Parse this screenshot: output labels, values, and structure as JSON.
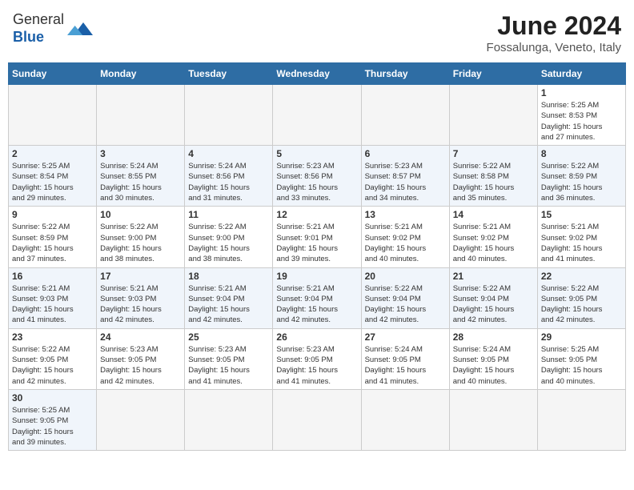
{
  "header": {
    "logo_text_normal": "General",
    "logo_text_bold": "Blue",
    "month_title": "June 2024",
    "location": "Fossalunga, Veneto, Italy"
  },
  "weekdays": [
    "Sunday",
    "Monday",
    "Tuesday",
    "Wednesday",
    "Thursday",
    "Friday",
    "Saturday"
  ],
  "weeks": [
    [
      {
        "day": "",
        "info": ""
      },
      {
        "day": "",
        "info": ""
      },
      {
        "day": "",
        "info": ""
      },
      {
        "day": "",
        "info": ""
      },
      {
        "day": "",
        "info": ""
      },
      {
        "day": "",
        "info": ""
      },
      {
        "day": "1",
        "info": "Sunrise: 5:25 AM\nSunset: 8:53 PM\nDaylight: 15 hours\nand 27 minutes."
      }
    ],
    [
      {
        "day": "2",
        "info": "Sunrise: 5:25 AM\nSunset: 8:54 PM\nDaylight: 15 hours\nand 29 minutes."
      },
      {
        "day": "3",
        "info": "Sunrise: 5:24 AM\nSunset: 8:55 PM\nDaylight: 15 hours\nand 30 minutes."
      },
      {
        "day": "4",
        "info": "Sunrise: 5:24 AM\nSunset: 8:56 PM\nDaylight: 15 hours\nand 31 minutes."
      },
      {
        "day": "5",
        "info": "Sunrise: 5:23 AM\nSunset: 8:56 PM\nDaylight: 15 hours\nand 33 minutes."
      },
      {
        "day": "6",
        "info": "Sunrise: 5:23 AM\nSunset: 8:57 PM\nDaylight: 15 hours\nand 34 minutes."
      },
      {
        "day": "7",
        "info": "Sunrise: 5:22 AM\nSunset: 8:58 PM\nDaylight: 15 hours\nand 35 minutes."
      },
      {
        "day": "8",
        "info": "Sunrise: 5:22 AM\nSunset: 8:59 PM\nDaylight: 15 hours\nand 36 minutes."
      }
    ],
    [
      {
        "day": "9",
        "info": "Sunrise: 5:22 AM\nSunset: 8:59 PM\nDaylight: 15 hours\nand 37 minutes."
      },
      {
        "day": "10",
        "info": "Sunrise: 5:22 AM\nSunset: 9:00 PM\nDaylight: 15 hours\nand 38 minutes."
      },
      {
        "day": "11",
        "info": "Sunrise: 5:22 AM\nSunset: 9:00 PM\nDaylight: 15 hours\nand 38 minutes."
      },
      {
        "day": "12",
        "info": "Sunrise: 5:21 AM\nSunset: 9:01 PM\nDaylight: 15 hours\nand 39 minutes."
      },
      {
        "day": "13",
        "info": "Sunrise: 5:21 AM\nSunset: 9:02 PM\nDaylight: 15 hours\nand 40 minutes."
      },
      {
        "day": "14",
        "info": "Sunrise: 5:21 AM\nSunset: 9:02 PM\nDaylight: 15 hours\nand 40 minutes."
      },
      {
        "day": "15",
        "info": "Sunrise: 5:21 AM\nSunset: 9:02 PM\nDaylight: 15 hours\nand 41 minutes."
      }
    ],
    [
      {
        "day": "16",
        "info": "Sunrise: 5:21 AM\nSunset: 9:03 PM\nDaylight: 15 hours\nand 41 minutes."
      },
      {
        "day": "17",
        "info": "Sunrise: 5:21 AM\nSunset: 9:03 PM\nDaylight: 15 hours\nand 42 minutes."
      },
      {
        "day": "18",
        "info": "Sunrise: 5:21 AM\nSunset: 9:04 PM\nDaylight: 15 hours\nand 42 minutes."
      },
      {
        "day": "19",
        "info": "Sunrise: 5:21 AM\nSunset: 9:04 PM\nDaylight: 15 hours\nand 42 minutes."
      },
      {
        "day": "20",
        "info": "Sunrise: 5:22 AM\nSunset: 9:04 PM\nDaylight: 15 hours\nand 42 minutes."
      },
      {
        "day": "21",
        "info": "Sunrise: 5:22 AM\nSunset: 9:04 PM\nDaylight: 15 hours\nand 42 minutes."
      },
      {
        "day": "22",
        "info": "Sunrise: 5:22 AM\nSunset: 9:05 PM\nDaylight: 15 hours\nand 42 minutes."
      }
    ],
    [
      {
        "day": "23",
        "info": "Sunrise: 5:22 AM\nSunset: 9:05 PM\nDaylight: 15 hours\nand 42 minutes."
      },
      {
        "day": "24",
        "info": "Sunrise: 5:23 AM\nSunset: 9:05 PM\nDaylight: 15 hours\nand 42 minutes."
      },
      {
        "day": "25",
        "info": "Sunrise: 5:23 AM\nSunset: 9:05 PM\nDaylight: 15 hours\nand 41 minutes."
      },
      {
        "day": "26",
        "info": "Sunrise: 5:23 AM\nSunset: 9:05 PM\nDaylight: 15 hours\nand 41 minutes."
      },
      {
        "day": "27",
        "info": "Sunrise: 5:24 AM\nSunset: 9:05 PM\nDaylight: 15 hours\nand 41 minutes."
      },
      {
        "day": "28",
        "info": "Sunrise: 5:24 AM\nSunset: 9:05 PM\nDaylight: 15 hours\nand 40 minutes."
      },
      {
        "day": "29",
        "info": "Sunrise: 5:25 AM\nSunset: 9:05 PM\nDaylight: 15 hours\nand 40 minutes."
      }
    ],
    [
      {
        "day": "30",
        "info": "Sunrise: 5:25 AM\nSunset: 9:05 PM\nDaylight: 15 hours\nand 39 minutes."
      },
      {
        "day": "",
        "info": ""
      },
      {
        "day": "",
        "info": ""
      },
      {
        "day": "",
        "info": ""
      },
      {
        "day": "",
        "info": ""
      },
      {
        "day": "",
        "info": ""
      },
      {
        "day": "",
        "info": ""
      }
    ]
  ]
}
